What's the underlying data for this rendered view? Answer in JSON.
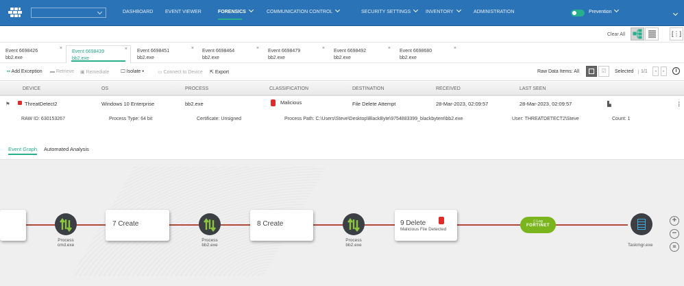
{
  "nav": {
    "items": [
      "DASHBOARD",
      "EVENT VIEWER",
      "FORENSICS",
      "COMMUNICATION CONTROL",
      "SECURITY SETTINGS",
      "INVENTORY",
      "ADMINISTRATION"
    ],
    "mode": "Prevention"
  },
  "toolbar_top": {
    "clear_all": "Clear All"
  },
  "tabs": [
    {
      "title": "Event 6698426",
      "sub": "bb2.exe"
    },
    {
      "title": "Event 6698439",
      "sub": "bb2.exe"
    },
    {
      "title": "Event 6698451",
      "sub": "bb2.exe"
    },
    {
      "title": "Event 6698464",
      "sub": "bb2.exe"
    },
    {
      "title": "Event 6698479",
      "sub": "bb2.exe"
    },
    {
      "title": "Event 6698492",
      "sub": "bb2.exe"
    },
    {
      "title": "Event 6698680",
      "sub": "bb2.exe"
    }
  ],
  "actions": {
    "add_exception": "Add Exception",
    "retrieve": "Retrieve",
    "remediate": "Remediate",
    "isolate": "Isolate",
    "connect": "Connect to Device",
    "export": "Export",
    "raw_data": "Raw Data Items: All",
    "selected": "Selected",
    "pager": "1/1"
  },
  "table": {
    "headers": [
      "DEVICE",
      "OS",
      "PROCESS",
      "CLASSIFICATION",
      "DESTINATION",
      "RECEIVED",
      "LAST SEEN"
    ],
    "row": {
      "device": "ThreatDetect2",
      "os": "Windows 10 Enterprise",
      "process": "bb2.exe",
      "classification": "Malicious",
      "destination": "File Delete Attempt",
      "received": "28-Mar-2023, 02:09:57",
      "last_seen": "28-Mar-2023, 02:09:57"
    },
    "details": {
      "raw_id_label": "RAW ID:",
      "raw_id": "630153267",
      "ptype_label": "Process Type:",
      "ptype": "64 bit",
      "cert_label": "Certificate:",
      "cert": "Unsigned",
      "path_label": "Process Path:",
      "path": "C:\\Users\\Steve\\Desktop\\BlackByte\\9754883399_blackbytent\\bb2.exe",
      "user_label": "User:",
      "user": "THREATDETECT2\\Steve",
      "count_label": "Count:",
      "count": "1"
    }
  },
  "subtabs": [
    "Event Graph",
    "Automated Analysis"
  ],
  "graph": {
    "boxes": [
      {
        "label": "7 Create"
      },
      {
        "label": "8 Create"
      },
      {
        "label": "9 Delete",
        "sub": "Malicious File Detected"
      }
    ],
    "processes": [
      {
        "l1": "Process",
        "l2": "cmd.exe"
      },
      {
        "l1": "Process",
        "l2": "bb2.exe"
      },
      {
        "l1": "Process",
        "l2": "bb2.exe"
      }
    ],
    "log": {
      "label": "Log",
      "brand": "FORTINET"
    },
    "target": "Taskmgr.exe"
  },
  "colors": {
    "brand": "#2b73b7",
    "accent": "#26b08e",
    "malicious": "#e02b2b",
    "edge": "#b0493a"
  }
}
